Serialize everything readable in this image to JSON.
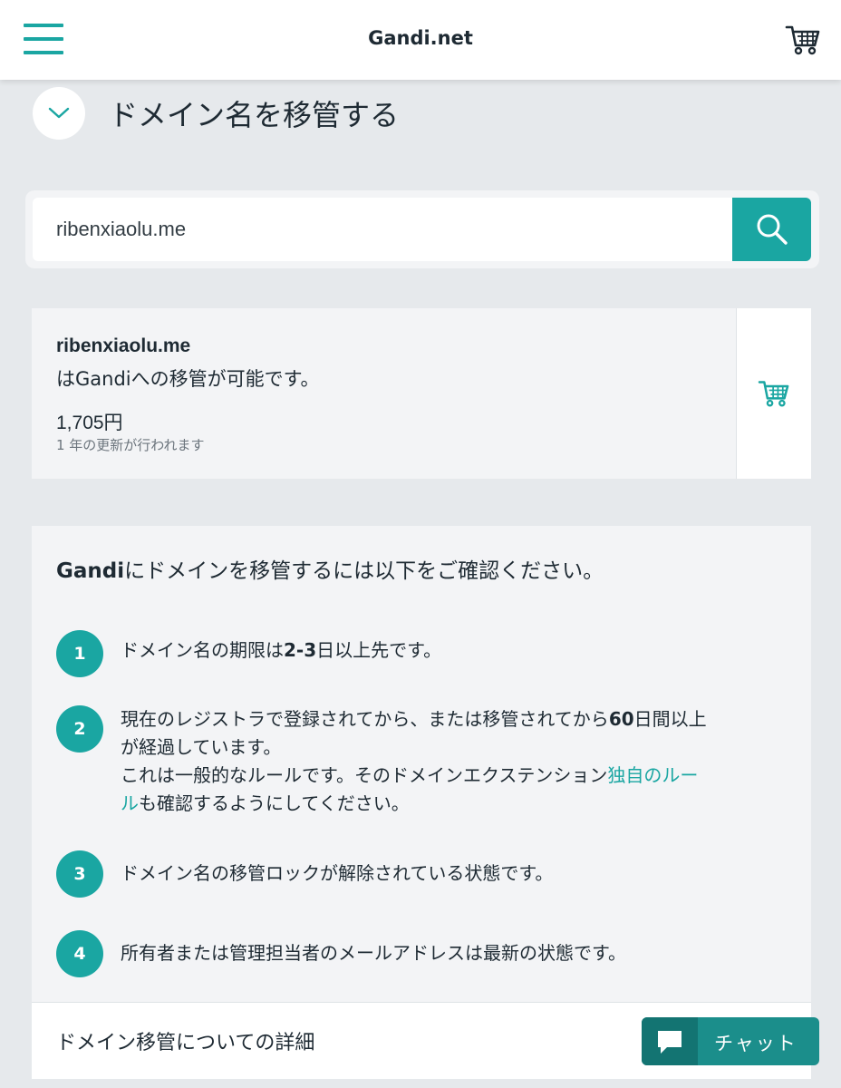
{
  "header": {
    "site_title": "Gandi.net",
    "menu_icon": "hamburger-menu-icon",
    "cart_icon": "shopping-cart-icon"
  },
  "page": {
    "title": "ドメイン名を移管する",
    "collapse_icon": "chevron-down-icon"
  },
  "search": {
    "value": "ribenxiaolu.me",
    "button_icon": "search-icon"
  },
  "result": {
    "domain": "ribenxiaolu.me",
    "status": "はGandiへの移管が可能です。",
    "price": "1,705円",
    "renewal_note": "1 年の更新が行われます",
    "cart_icon": "add-to-cart-icon"
  },
  "requirements": {
    "heading_brand": "Gandi",
    "heading_rest": "にドメインを移管するには以下をご確認ください。",
    "steps": [
      {
        "number": "1",
        "text_before": "ドメイン名の期限は",
        "text_bold": "2-3",
        "text_after": "日以上先です。"
      },
      {
        "number": "2",
        "line1_before": "現在のレジストラで登録されてから、または移管されてから",
        "line1_bold": "60",
        "line1_after": "日間以上",
        "line2": "が経過しています。",
        "line3_before": "これは一般的なルールです。そのドメインエクステンション",
        "link_part1": "独自のルー",
        "link_part2": "ル",
        "line4_after": "も確認するようにしてください。"
      },
      {
        "number": "3",
        "text": "ドメイン名の移管ロックが解除されている状態です。"
      },
      {
        "number": "4",
        "text": "所有者または管理担当者のメールアドレスは最新の状態です。"
      }
    ]
  },
  "details": {
    "label": "ドメイン移管についての詳細"
  },
  "chat": {
    "label": "チャット",
    "icon": "chat-bubble-icon"
  },
  "colors": {
    "accent": "#1aa6a2",
    "chat_bg": "#1b8e8b",
    "page_bg": "#e6e9ec",
    "card_bg": "#f3f4f6"
  }
}
